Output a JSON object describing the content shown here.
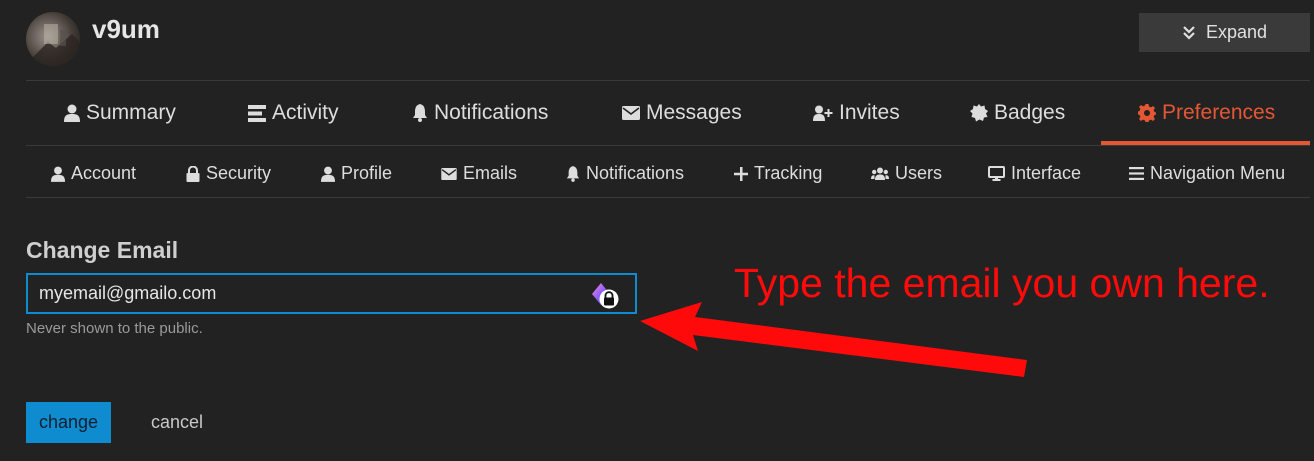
{
  "header": {
    "username": "v9um",
    "expand_label": "Expand"
  },
  "primary_nav": [
    {
      "label": "Summary",
      "icon": "user-icon"
    },
    {
      "label": "Activity",
      "icon": "stream-icon"
    },
    {
      "label": "Notifications",
      "icon": "bell-icon"
    },
    {
      "label": "Messages",
      "icon": "envelope-icon"
    },
    {
      "label": "Invites",
      "icon": "user-plus-icon"
    },
    {
      "label": "Badges",
      "icon": "certificate-icon"
    },
    {
      "label": "Preferences",
      "icon": "cog-icon",
      "active": true
    }
  ],
  "secondary_nav": [
    {
      "label": "Account",
      "icon": "user-icon"
    },
    {
      "label": "Security",
      "icon": "lock-icon"
    },
    {
      "label": "Profile",
      "icon": "user-icon"
    },
    {
      "label": "Emails",
      "icon": "envelope-icon"
    },
    {
      "label": "Notifications",
      "icon": "bell-icon"
    },
    {
      "label": "Tracking",
      "icon": "plus-icon"
    },
    {
      "label": "Users",
      "icon": "users-icon"
    },
    {
      "label": "Interface",
      "icon": "desktop-icon"
    },
    {
      "label": "Navigation Menu",
      "icon": "bars-icon"
    }
  ],
  "form": {
    "heading": "Change Email",
    "email_value": "myemail@gmailo.com",
    "help_text": "Never shown to the public.",
    "change_label": "change",
    "cancel_label": "cancel"
  },
  "annotation": {
    "text": "Type the email you own here.",
    "color": "#ff0a0a"
  },
  "colors": {
    "accent": "#e45735",
    "primary_button": "#0e8ccf",
    "background": "#222222"
  }
}
